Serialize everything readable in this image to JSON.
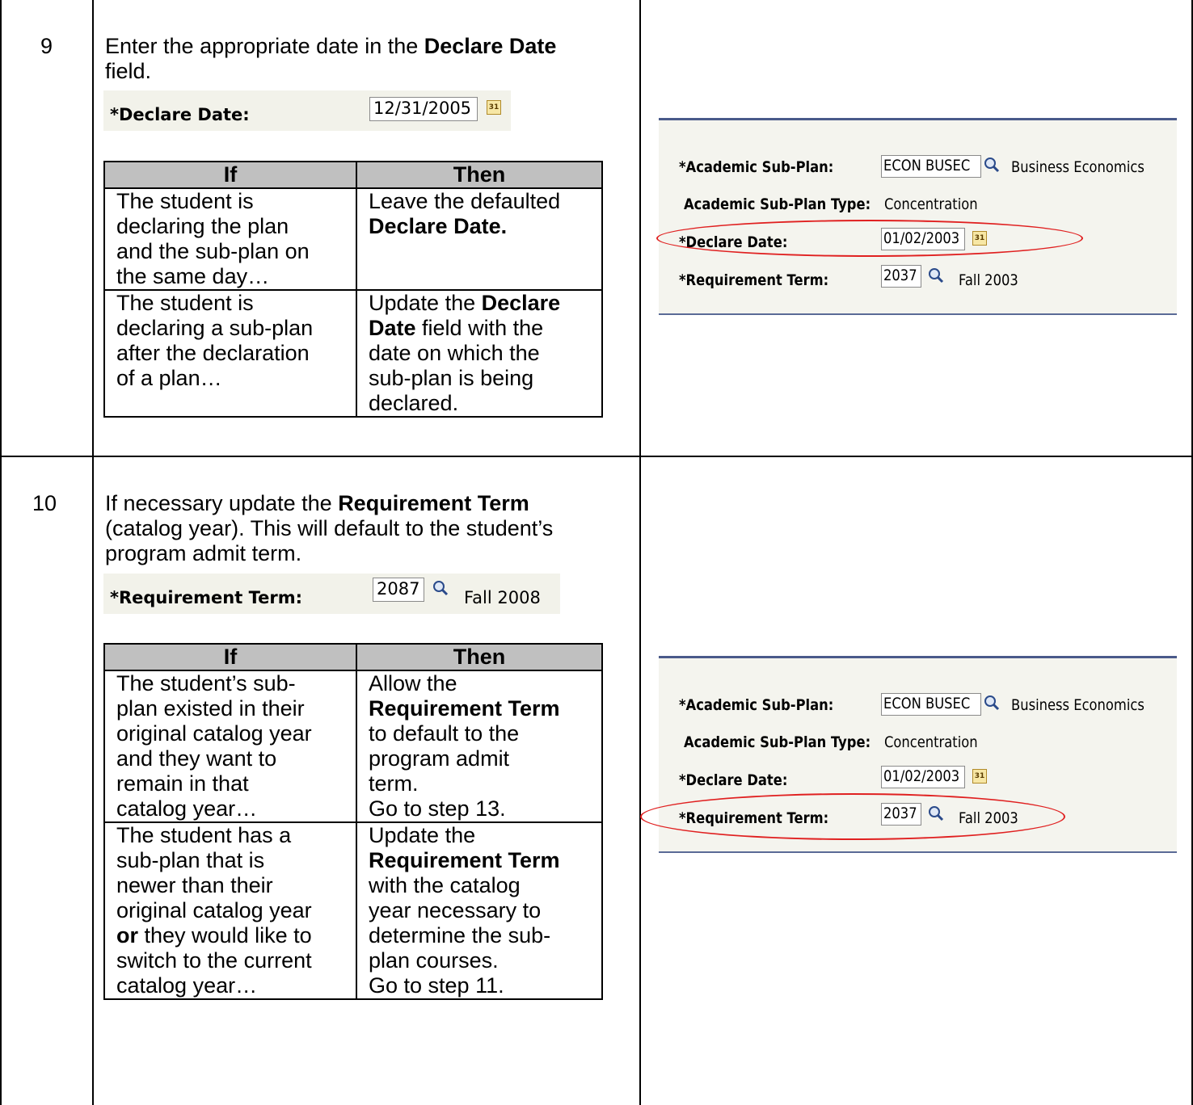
{
  "step9": {
    "number": "9",
    "instruction_pre": "Enter the appropriate date in the ",
    "instruction_bold": "Declare Date",
    "instruction_post": "field.",
    "field": {
      "label": "*Declare Date:",
      "value": "12/31/2005",
      "icon": "calendar-icon"
    },
    "table": {
      "headers": [
        "If",
        "Then"
      ],
      "rows": [
        {
          "if_lines": [
            "The student is",
            "declaring the plan",
            "and the sub-plan on",
            "the same day…"
          ],
          "then_lines": [
            "Leave the defaulted"
          ],
          "then_bold": "Declare Date."
        },
        {
          "if_lines": [
            "The student is",
            "declaring a sub-plan",
            "after the declaration",
            "of a plan…"
          ],
          "then_pre": "Update the ",
          "then_bold1": "Declare",
          "then_bold2": "Date",
          "then_post": " field with the",
          "then_lines": [
            "date on which the",
            "sub-plan is being",
            "declared."
          ]
        }
      ]
    },
    "screenshot": {
      "subplan_label": "*Academic Sub-Plan:",
      "subplan_value": "ECON BUSEC",
      "subplan_desc": "Business Economics",
      "type_label": "Academic Sub-Plan Type:",
      "type_value": "Concentration",
      "date_label": "*Declare Date:",
      "date_value": "01/02/2003",
      "term_label": "*Requirement Term:",
      "term_value": "2037",
      "term_desc": "Fall 2003"
    }
  },
  "step10": {
    "number": "10",
    "line1_pre": "If necessary update the ",
    "line1_bold": "Requirement Term",
    "line2": "(catalog year).  This will default to the student’s",
    "line3": "program admit term.",
    "field": {
      "label": "*Requirement Term:",
      "value": "2087",
      "desc": "Fall 2008",
      "icon": "search-icon"
    },
    "table": {
      "headers": [
        "If",
        "Then"
      ],
      "rows": [
        {
          "if_lines": [
            "The student’s sub-",
            "plan existed in their",
            "original catalog year",
            "and they want to",
            "remain in that",
            "catalog year…"
          ],
          "then_a": "Allow the",
          "then_bold": "Requirement Term",
          "then_lines": [
            "to default to the",
            "program admit",
            "term.",
            "Go to step 13."
          ]
        },
        {
          "if_lines": [
            "The student has a",
            "sub-plan that is",
            "newer than their",
            "original catalog year"
          ],
          "if_bold": "or",
          "if_after": " they would like to",
          "if_tail": [
            "switch to the current",
            "catalog year…"
          ],
          "then_a": "Update the",
          "then_bold": "Requirement Term",
          "then_lines": [
            "with the catalog",
            "year necessary to",
            "determine the sub-",
            "plan courses.",
            "Go to step 11."
          ]
        }
      ]
    },
    "screenshot": {
      "subplan_label": "*Academic Sub-Plan:",
      "subplan_value": "ECON BUSEC",
      "subplan_desc": "Business Economics",
      "type_label": "Academic Sub-Plan Type:",
      "type_value": "Concentration",
      "date_label": "*Declare Date:",
      "date_value": "01/02/2003",
      "term_label": "*Requirement Term:",
      "term_value": "2037",
      "term_desc": "Fall 2003"
    }
  }
}
